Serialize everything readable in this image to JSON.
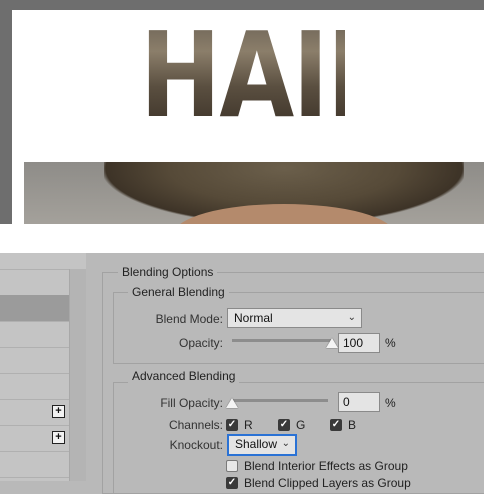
{
  "canvas": {
    "headline": "HAIR"
  },
  "layers_panel": {
    "expand_glyph": "+"
  },
  "blending_options": {
    "title": "Blending Options",
    "general": {
      "title": "General Blending",
      "blend_mode_label": "Blend Mode:",
      "blend_mode_value": "Normal",
      "opacity_label": "Opacity:",
      "opacity_value": "100",
      "opacity_level": 100,
      "opacity_unit": "%"
    },
    "advanced": {
      "title": "Advanced Blending",
      "fill_opacity_label": "Fill Opacity:",
      "fill_opacity_value": "0",
      "fill_opacity_level": 0,
      "fill_opacity_unit": "%",
      "channels_label": "Channels:",
      "channel_r": "R",
      "channel_g": "G",
      "channel_b": "B",
      "knockout_label": "Knockout:",
      "knockout_value": "Shallow",
      "blend_interior_label": "Blend Interior Effects as Group",
      "blend_clipped_label": "Blend Clipped Layers as Group"
    }
  },
  "icons": {
    "chevron": "chevron-down-icon",
    "checkmark": "checkmark-icon"
  }
}
